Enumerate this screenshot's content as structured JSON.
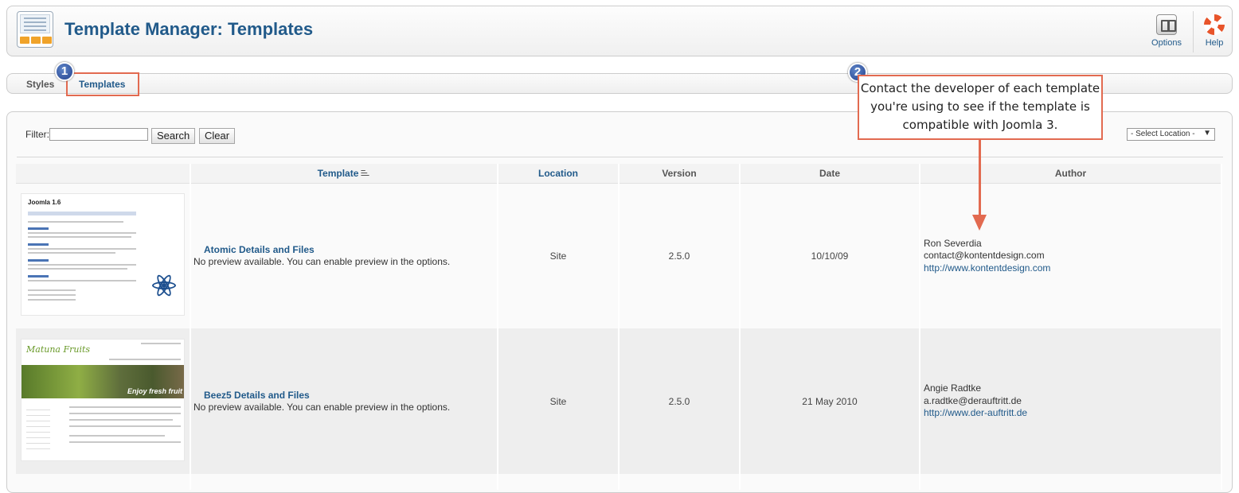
{
  "header": {
    "title": "Template Manager: Templates",
    "options_label": "Options",
    "help_label": "Help"
  },
  "tabs": [
    {
      "label": "Styles"
    },
    {
      "label": "Templates"
    }
  ],
  "filter": {
    "label": "Filter:",
    "value": "",
    "search_label": "Search",
    "clear_label": "Clear",
    "location_select": "- Select Location -"
  },
  "table": {
    "columns": [
      "",
      "Template",
      "Location",
      "Version",
      "Date",
      "Author"
    ],
    "rows": [
      {
        "name": "Atomic Details and Files",
        "note": "No preview available. You can enable preview in the options.",
        "location": "Site",
        "version": "2.5.0",
        "date": "10/10/09",
        "author": "Ron Severdia",
        "email": "contact@kontentdesign.com",
        "url": "http://www.kontentdesign.com"
      },
      {
        "name": "Beez5 Details and Files",
        "note": "No preview available. You can enable preview in the options.",
        "location": "Site",
        "version": "2.5.0",
        "date": "21 May 2010",
        "author": "Angie Radtke",
        "email": "a.radtke@derauftritt.de",
        "url": "http://www.der-auftritt.de"
      }
    ]
  },
  "thumbnails": {
    "atomic_title": "Joomla 1.6",
    "beez_brand": "Matuna Fruits",
    "beez_banner": "Enjoy fresh fruit"
  },
  "annotations": {
    "badge1": "1",
    "badge2": "2",
    "callout": "Contact the developer of each template you're using to see if the template is compatible with Joomla 3."
  },
  "colors": {
    "title_blue": "#215a8a",
    "annotation_red": "#e26a50",
    "badge_blue": "#23418d"
  }
}
